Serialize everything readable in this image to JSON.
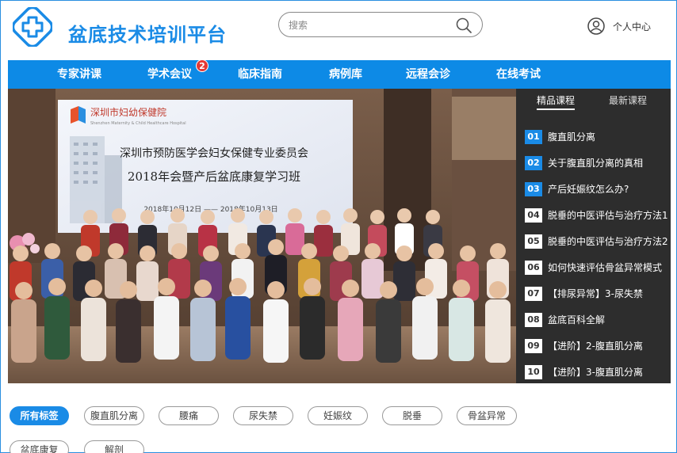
{
  "header": {
    "brand": "盆底技术培训平台",
    "search_placeholder": "搜索",
    "user_label": "个人中心"
  },
  "nav": {
    "items": [
      {
        "label": "专家讲课"
      },
      {
        "label": "学术会议",
        "badge": "2"
      },
      {
        "label": "临床指南"
      },
      {
        "label": "病例库"
      },
      {
        "label": "远程会诊"
      },
      {
        "label": "在线考试"
      }
    ]
  },
  "banner": {
    "org_name": "深圳市妇幼保健院",
    "org_english": "Shenzhen Maternity & Child Healthcare Hospital",
    "line1": "深圳市预防医学会妇女保健专业委员会",
    "line2": "2018年会暨产后盆底康复学习班",
    "dates": "2018年10月12日 —— 2018年10月13日"
  },
  "courses": {
    "tabs": [
      "精品课程",
      "最新课程"
    ],
    "active_tab": 0,
    "items": [
      {
        "num": "01",
        "title": "腹直肌分离"
      },
      {
        "num": "02",
        "title": "关于腹直肌分离的真相"
      },
      {
        "num": "03",
        "title": "产后妊娠纹怎么办?"
      },
      {
        "num": "04",
        "title": "脱垂的中医评估与治疗方法1"
      },
      {
        "num": "05",
        "title": "脱垂的中医评估与治疗方法2"
      },
      {
        "num": "06",
        "title": "如何快速评估骨盆异常模式"
      },
      {
        "num": "07",
        "title": "【排尿异常】3-尿失禁"
      },
      {
        "num": "08",
        "title": "盆底百科全解"
      },
      {
        "num": "09",
        "title": "【进阶】2-腹直肌分离"
      },
      {
        "num": "10",
        "title": "【进阶】3-腹直肌分离"
      }
    ]
  },
  "tags": {
    "items": [
      "所有标签",
      "腹直肌分离",
      "腰痛",
      "尿失禁",
      "妊娠纹",
      "脱垂",
      "骨盆异常",
      "盆底康复",
      "解剖"
    ],
    "active": 0
  },
  "colors": {
    "brand": "#1a8be6",
    "nav_bg": "#0d8ae6",
    "badge": "#e53935",
    "panel_bg": "#2d2d2d"
  }
}
